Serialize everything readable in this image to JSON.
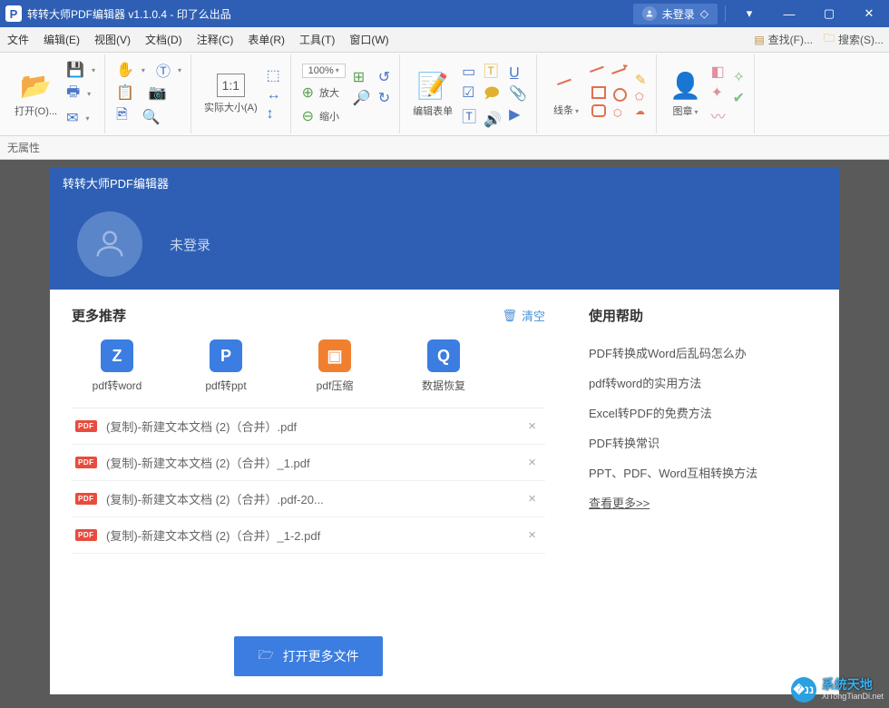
{
  "titlebar": {
    "app_icon_letter": "P",
    "title": "转转大师PDF编辑器 v1.1.0.4 - 印了么出品",
    "login_status": "未登录"
  },
  "menubar": {
    "items": [
      "文件",
      "编辑(E)",
      "视图(V)",
      "文档(D)",
      "注释(C)",
      "表单(R)",
      "工具(T)",
      "窗口(W)"
    ],
    "find_label": "查找(F)...",
    "search_label": "搜索(S)..."
  },
  "ribbon": {
    "open_label": "打开(O)...",
    "actual_size_label": "实际大小(A)",
    "zoom_value": "100%",
    "zoom_in_label": "放大",
    "zoom_out_label": "缩小",
    "edit_form_label": "编辑表单",
    "lines_label": "线条",
    "stamp_label": "图章"
  },
  "attrbar": {
    "text": "无属性"
  },
  "panel": {
    "header": "转转大师PDF编辑器",
    "login_text": "未登录",
    "recommend_title": "更多推荐",
    "clear_label": "清空",
    "rec_items": [
      {
        "icon": "Z",
        "cls": "ri-blue",
        "label": "pdf转word"
      },
      {
        "icon": "P",
        "cls": "ri-blue",
        "label": "pdf转ppt"
      },
      {
        "icon": "▣",
        "cls": "ri-orange",
        "label": "pdf压缩"
      },
      {
        "icon": "Q",
        "cls": "ri-blue",
        "label": "数据恢复"
      }
    ],
    "files": [
      "(复制)-新建文本文档 (2)（合并）.pdf",
      "(复制)-新建文本文档 (2)（合并）_1.pdf",
      "(复制)-新建文本文档 (2)（合并）.pdf-20...",
      "(复制)-新建文本文档 (2)（合并）_1-2.pdf"
    ],
    "open_more_label": "打开更多文件",
    "help_title": "使用帮助",
    "help_items": [
      "PDF转换成Word后乱码怎么办",
      "pdf转word的实用方法",
      "Excel转PDF的免费方法",
      "PDF转换常识",
      "PPT、PDF、Word互相转换方法"
    ],
    "help_more": "查看更多>>"
  },
  "watermark": {
    "cn": "系统天地",
    "en": "XiTongTianDi.net"
  }
}
